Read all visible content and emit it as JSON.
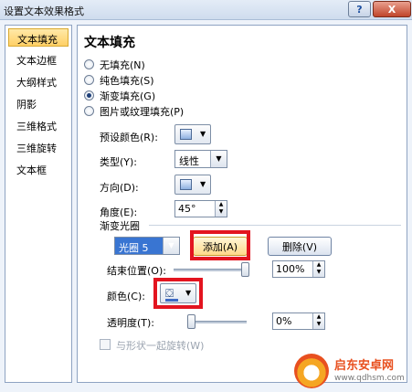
{
  "window": {
    "title": "设置文本效果格式",
    "help_label": "?",
    "close_label": "X"
  },
  "sidebar": {
    "items": [
      {
        "label": "文本填充",
        "selected": true
      },
      {
        "label": "文本边框"
      },
      {
        "label": "大纲样式"
      },
      {
        "label": "阴影"
      },
      {
        "label": "三维格式"
      },
      {
        "label": "三维旋转"
      },
      {
        "label": "文本框"
      }
    ]
  },
  "panel": {
    "heading": "文本填充",
    "fill_options": [
      {
        "label": "无填充(N)",
        "selected": false
      },
      {
        "label": "纯色填充(S)",
        "selected": false
      },
      {
        "label": "渐变填充(G)",
        "selected": true
      },
      {
        "label": "图片或纹理填充(P)",
        "selected": false
      }
    ],
    "preset_colors_label": "预设颜色(R):",
    "type_label": "类型(Y):",
    "type_value": "线性",
    "direction_label": "方向(D):",
    "angle_label": "角度(E):",
    "angle_value": "45°",
    "gradient_stops_label": "渐变光圈",
    "stop_value": "光圈 5",
    "add_button": "添加(A)",
    "delete_button": "删除(V)",
    "end_position_label": "结束位置(O):",
    "end_position_value": "100%",
    "end_position_level": 1.0,
    "color_label": "颜色(C):",
    "transparency_label": "透明度(T):",
    "transparency_value": "0%",
    "transparency_level": 0.0,
    "rotate_with_shape_label": "与形状一起旋转(W)"
  },
  "watermark": {
    "name": "启东安卓网",
    "url": "www.qdhsm.com"
  },
  "colors": {
    "highlight": "#e3141f",
    "selection": "#ffd066",
    "border": "#8ea3c2"
  }
}
